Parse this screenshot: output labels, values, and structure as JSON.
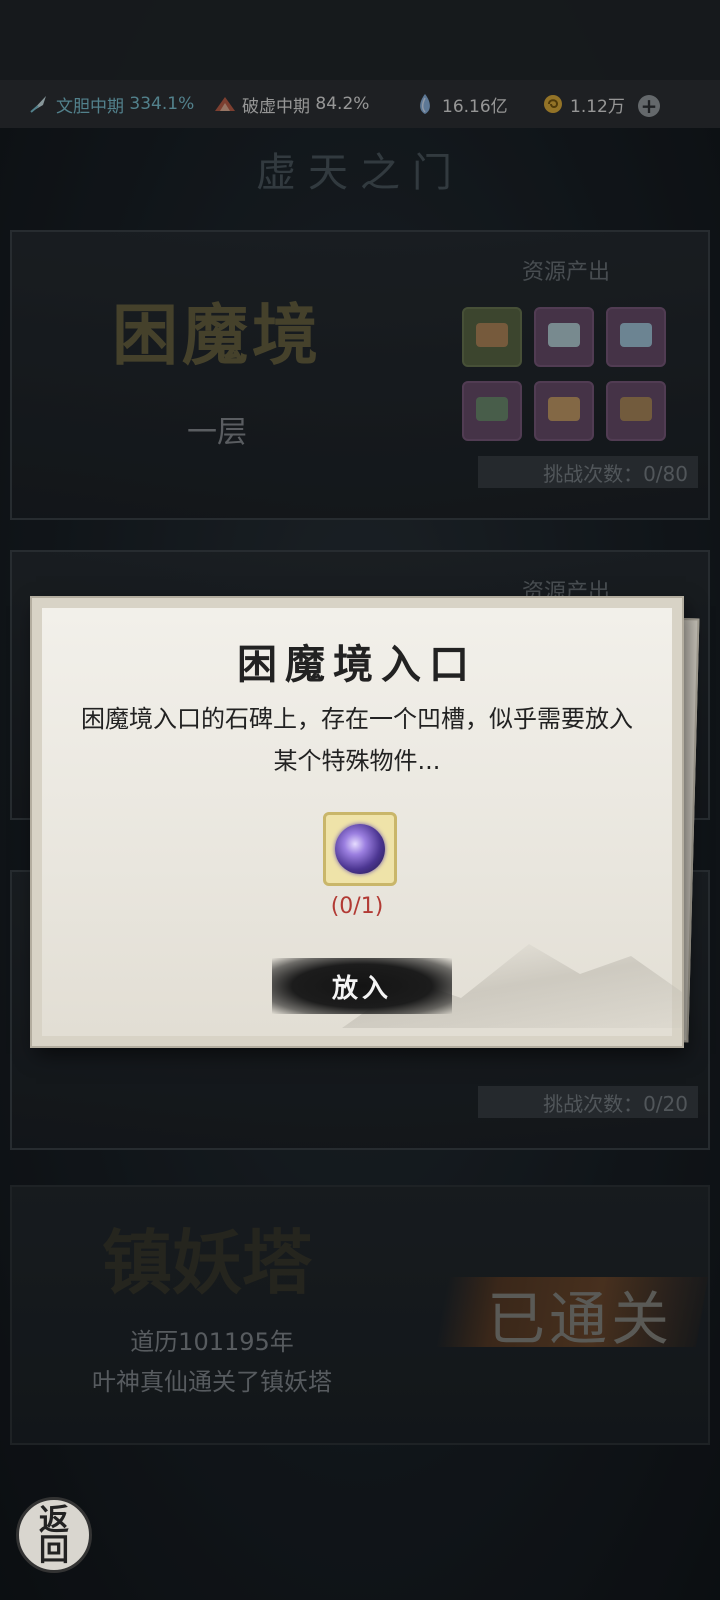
{
  "resources": {
    "item1": {
      "label": "文胆中期",
      "value": "334.1%"
    },
    "item2": {
      "label": "破虚中期",
      "value": "84.2%"
    },
    "item3": {
      "value": "16.16亿"
    },
    "item4": {
      "value": "1.12万"
    }
  },
  "page": {
    "title": "虚天之门"
  },
  "panel1": {
    "name": "困魔境",
    "floor": "一层",
    "output_label": "资源产出",
    "challenge": "挑战次数：0/80"
  },
  "panel2": {
    "output_label": "资源产出"
  },
  "panel3": {
    "challenge": "挑战次数：0/20"
  },
  "panel4": {
    "name": "镇妖塔",
    "info_line1": "道历101195年",
    "info_line2": "叶神真仙通关了镇妖塔",
    "status": "已通关"
  },
  "dialog": {
    "title": "困魔境入口",
    "description": "困魔境入口的石碑上，存在一个凹槽，似乎需要放入某个特殊物件...",
    "required_count": "(0/1)",
    "button_label": "放入"
  },
  "back_button": {
    "line1": "返",
    "line2": "回"
  }
}
